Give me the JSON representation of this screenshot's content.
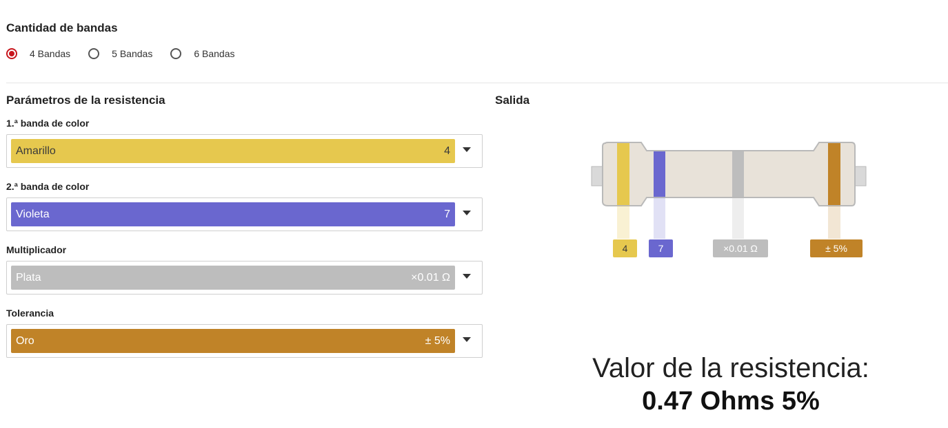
{
  "band_count": {
    "title": "Cantidad de bandas",
    "options": [
      {
        "label": "4 Bandas",
        "checked": true
      },
      {
        "label": "5 Bandas",
        "checked": false
      },
      {
        "label": "6 Bandas",
        "checked": false
      }
    ]
  },
  "parameters": {
    "title": "Parámetros de la resistencia",
    "fields": [
      {
        "label": "1.ª banda de color",
        "color_name": "Amarillo",
        "value": "4",
        "color": "#e6c84e",
        "text_color": "#3a3a3a"
      },
      {
        "label": "2.ª banda de color",
        "color_name": "Violeta",
        "value": "7",
        "color": "#6a67cf",
        "text_color": "#ffffff"
      },
      {
        "label": "Multiplicador",
        "color_name": "Plata",
        "value": "×0.01 Ω",
        "color": "#bdbdbd",
        "text_color": "#ffffff"
      },
      {
        "label": "Tolerancia",
        "color_name": "Oro",
        "value": "± 5%",
        "color": "#c08328",
        "text_color": "#ffffff"
      }
    ]
  },
  "output": {
    "title": "Salida",
    "tags": [
      "4",
      "7",
      "×0.01 Ω",
      "± 5%"
    ],
    "result_label": "Valor de la resistencia:",
    "result_value": "0.47 Ohms 5%"
  },
  "colors": {
    "accent_radio": "#c8161d",
    "resistor_body": "#e8e2d9",
    "resistor_outline": "#b9b9b9",
    "lead": "#d9d9d9"
  },
  "icons": {
    "dropdown": "chevron-down-icon",
    "radio": "radio-icon"
  }
}
